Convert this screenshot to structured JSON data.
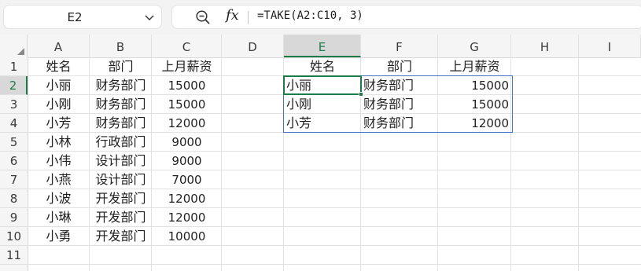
{
  "formula_bar": {
    "name_box": "E2",
    "formula": "=TAKE(A2:C10, 3)",
    "fx_label": "fx"
  },
  "columns": [
    "A",
    "B",
    "C",
    "D",
    "E",
    "F",
    "G",
    "H",
    "I"
  ],
  "rows": [
    "1",
    "2",
    "3",
    "4",
    "5",
    "6",
    "7",
    "8",
    "9",
    "10",
    "11"
  ],
  "active_cell": {
    "column": "E",
    "row": "2"
  },
  "source_table": {
    "headers": [
      "姓名",
      "部门",
      "上月薪资"
    ],
    "rows": [
      [
        "小丽",
        "财务部门",
        "15000"
      ],
      [
        "小刚",
        "财务部门",
        "15000"
      ],
      [
        "小芳",
        "财务部门",
        "12000"
      ],
      [
        "小林",
        "行政部门",
        "9000"
      ],
      [
        "小伟",
        "设计部门",
        "9000"
      ],
      [
        "小燕",
        "设计部门",
        "7000"
      ],
      [
        "小波",
        "开发部门",
        "12000"
      ],
      [
        "小琳",
        "开发部门",
        "12000"
      ],
      [
        "小勇",
        "开发部门",
        "10000"
      ]
    ]
  },
  "result_table": {
    "headers": [
      "姓名",
      "部门",
      "上月薪资"
    ],
    "rows": [
      [
        "小丽",
        "财务部门",
        "15000"
      ],
      [
        "小刚",
        "财务部门",
        "15000"
      ],
      [
        "小芳",
        "财务部门",
        "12000"
      ]
    ]
  },
  "colors": {
    "active_green": "#1f7a4a",
    "spill_border": "#4472c4",
    "header_bg": "#f5f5f5",
    "gridline": "#e1e1e1"
  }
}
